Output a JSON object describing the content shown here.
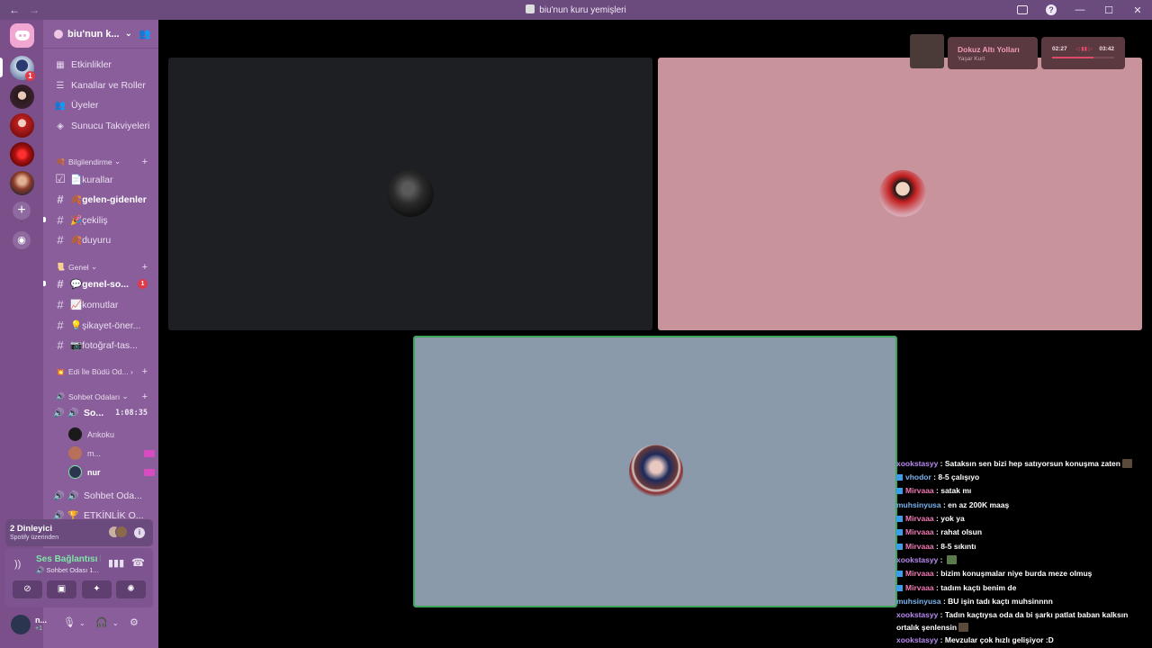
{
  "window": {
    "title": "biu'nun kuru yemişleri",
    "nav_back": "←",
    "nav_forward": "→",
    "minimize": "—",
    "maximize": "☐",
    "close": "✕",
    "help": "?"
  },
  "server": {
    "name": "biu'nun k...",
    "menu": [
      {
        "icon": "calendar-icon",
        "label": "Etkinlikler"
      },
      {
        "icon": "list-icon",
        "label": "Kanallar ve Roller"
      },
      {
        "icon": "members-icon",
        "label": "Üyeler"
      },
      {
        "icon": "boost-icon",
        "label": "Sunucu Takviyeleri"
      }
    ]
  },
  "rail": {
    "badge_count": "1"
  },
  "categories": {
    "bilgilendirme": "Bilgilendirme",
    "genel": "Genel",
    "edi": "Edi İle Büdü Od...",
    "sohbet": "Sohbet Odaları"
  },
  "channels": {
    "kurallar": "📄kurallar",
    "gelen": "🍂gelen-gidenler",
    "cekilis": "🎉çekiliş",
    "duyuru": "🍂duyuru",
    "genel_sohbet": "💬genel-so...",
    "genel_sohbet_mentions": "1",
    "komutlar": "📈komutlar",
    "sikayet": "💡şikayet-öner...",
    "fotograf": "📷fotoğraf-tas..."
  },
  "voice": {
    "active_room": "So...",
    "timer": "1:08:35",
    "members": [
      "Ankoku",
      "m...",
      "nur"
    ],
    "room2": "Sohbet Oda...",
    "room3": "ETKİNLİK O..."
  },
  "listening": {
    "title": "2 Dinleyici",
    "subtitle": "Spotify üzerinden",
    "info": "i"
  },
  "voice_status": {
    "title": "Ses Bağlantısı K",
    "channel": "Sohbet Odası 1..."
  },
  "user": {
    "name": "n...",
    "sub": "+1"
  },
  "spotify": {
    "song": "Dokuz Altı Yolları",
    "artist": "Yaşar Kurt",
    "current": "02:27",
    "duration": "03:42",
    "progress": 0.66
  },
  "chat": [
    {
      "user": "xookstasyy",
      "text": " : Sataksın sen bizi hep satıyorsun konuşma zaten",
      "emote": true,
      "color": "u1",
      "badge": false
    },
    {
      "user": "vhodor",
      "text": " : 8-5 çalışıyo",
      "color": "u2",
      "badge": true
    },
    {
      "user": "Mirvaaa",
      "text": " : satak mı",
      "color": "u3",
      "badge": true
    },
    {
      "user": "muhsinyusa",
      "text": " : en az 200K maaş",
      "color": "u2",
      "badge": false
    },
    {
      "user": "Mirvaaa",
      "text": " : yok ya",
      "color": "u3",
      "badge": true
    },
    {
      "user": "Mirvaaa",
      "text": " : rahat olsun",
      "color": "u3",
      "badge": true
    },
    {
      "user": "Mirvaaa",
      "text": " : 8-5 sıkıntı",
      "color": "u3",
      "badge": true
    },
    {
      "user": "xookstasyy",
      "text": " : ",
      "emote_green": true,
      "color": "u1",
      "badge": false
    },
    {
      "user": "Mirvaaa",
      "text": " : bizim konuşmalar niye burda meze olmuş",
      "color": "u3",
      "badge": true
    },
    {
      "user": "Mirvaaa",
      "text": " : tadım kaçtı benim de",
      "color": "u3",
      "badge": true
    },
    {
      "user": "muhsinyusa",
      "text": " : BU işin tadı kaçtı muhsinnnn",
      "color": "u2",
      "badge": false
    },
    {
      "user": "xookstasyy",
      "text": " : Tadın kaçtıysa oda da bi şarkı patlat baban kalksın ortalık şenlensin",
      "emote": true,
      "color": "u1",
      "badge": false
    },
    {
      "user": "xookstasyy",
      "text": " : Mevzular çok hızlı gelişiyor :D",
      "color": "u1",
      "badge": false
    }
  ]
}
